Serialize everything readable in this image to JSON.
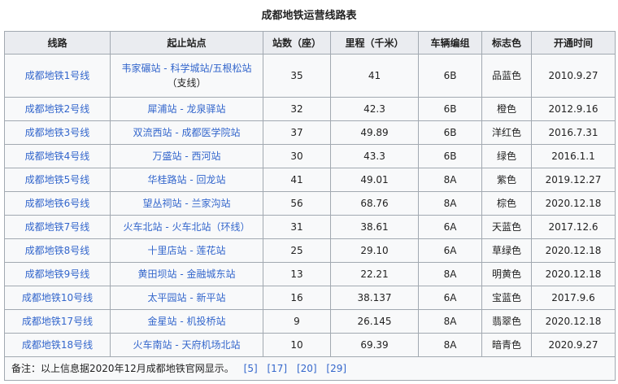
{
  "caption": "成都地铁运营线路表",
  "headers": [
    "线路",
    "起止站点",
    "站数（座）",
    "里程（千米）",
    "车辆编组",
    "标志色",
    "开通时间"
  ],
  "rows": [
    {
      "line": "成都地铁1号线",
      "stations_line1": "韦家碾站 - 科学城站/五根松站",
      "stations_line2": "（支线）",
      "count": "35",
      "km": "41",
      "cars": "6B",
      "color": "品蓝色",
      "opened": "2010.9.27"
    },
    {
      "line": "成都地铁2号线",
      "stations_line1": "犀浦站 - 龙泉驿站",
      "stations_line2": "",
      "count": "32",
      "km": "42.3",
      "cars": "6B",
      "color": "橙色",
      "opened": "2012.9.16"
    },
    {
      "line": "成都地铁3号线",
      "stations_line1": "双流西站 - 成都医学院站",
      "stations_line2": "",
      "count": "37",
      "km": "49.89",
      "cars": "6B",
      "color": "洋红色",
      "opened": "2016.7.31"
    },
    {
      "line": "成都地铁4号线",
      "stations_line1": "万盛站 - 西河站",
      "stations_line2": "",
      "count": "30",
      "km": "43.3",
      "cars": "6B",
      "color": "绿色",
      "opened": "2016.1.1"
    },
    {
      "line": "成都地铁5号线",
      "stations_line1": "华桂路站 - 回龙站",
      "stations_line2": "",
      "count": "41",
      "km": "49.01",
      "cars": "8A",
      "color": "紫色",
      "opened": "2019.12.27"
    },
    {
      "line": "成都地铁6号线",
      "stations_line1": "望丛祠站 - 兰家沟站",
      "stations_line2": "",
      "count": "56",
      "km": "68.76",
      "cars": "8A",
      "color": "棕色",
      "opened": "2020.12.18"
    },
    {
      "line": "成都地铁7号线",
      "stations_line1": "火车北站 - 火车北站（环线）",
      "stations_line2": "",
      "count": "31",
      "km": "38.61",
      "cars": "6A",
      "color": "天蓝色",
      "opened": "2017.12.6"
    },
    {
      "line": "成都地铁8号线",
      "stations_line1": "十里店站 - 莲花站",
      "stations_line2": "",
      "count": "25",
      "km": "29.10",
      "cars": "6A",
      "color": "草绿色",
      "opened": "2020.12.18"
    },
    {
      "line": "成都地铁9号线",
      "stations_line1": "黄田坝站 - 金融城东站",
      "stations_line2": "",
      "count": "13",
      "km": "22.21",
      "cars": "8A",
      "color": "明黄色",
      "opened": "2020.12.18"
    },
    {
      "line": "成都地铁10号线",
      "stations_line1": "太平园站 - 新平站",
      "stations_line2": "",
      "count": "16",
      "km": "38.137",
      "cars": "6A",
      "color": "宝蓝色",
      "opened": "2017.9.6"
    },
    {
      "line": "成都地铁17号线",
      "stations_line1": "金星站 - 机投桥站",
      "stations_line2": "",
      "count": "9",
      "km": "26.145",
      "cars": "8A",
      "color": "翡翠色",
      "opened": "2020.12.18"
    },
    {
      "line": "成都地铁18号线",
      "stations_line1": "火车南站 - 天府机场北站",
      "stations_line2": "",
      "count": "10",
      "km": "69.39",
      "cars": "8A",
      "color": "暗青色",
      "opened": "2020.9.27"
    }
  ],
  "note": "备注：以上信息据2020年12月成都地铁官网显示。",
  "refs": [
    "[5]",
    "[17]",
    "[20]",
    "[29]"
  ],
  "colors": {
    "link": "#3366cc",
    "header_bg": "#eaecf0",
    "cell_bg": "#f8f9fa",
    "border": "#a2a9b1"
  }
}
